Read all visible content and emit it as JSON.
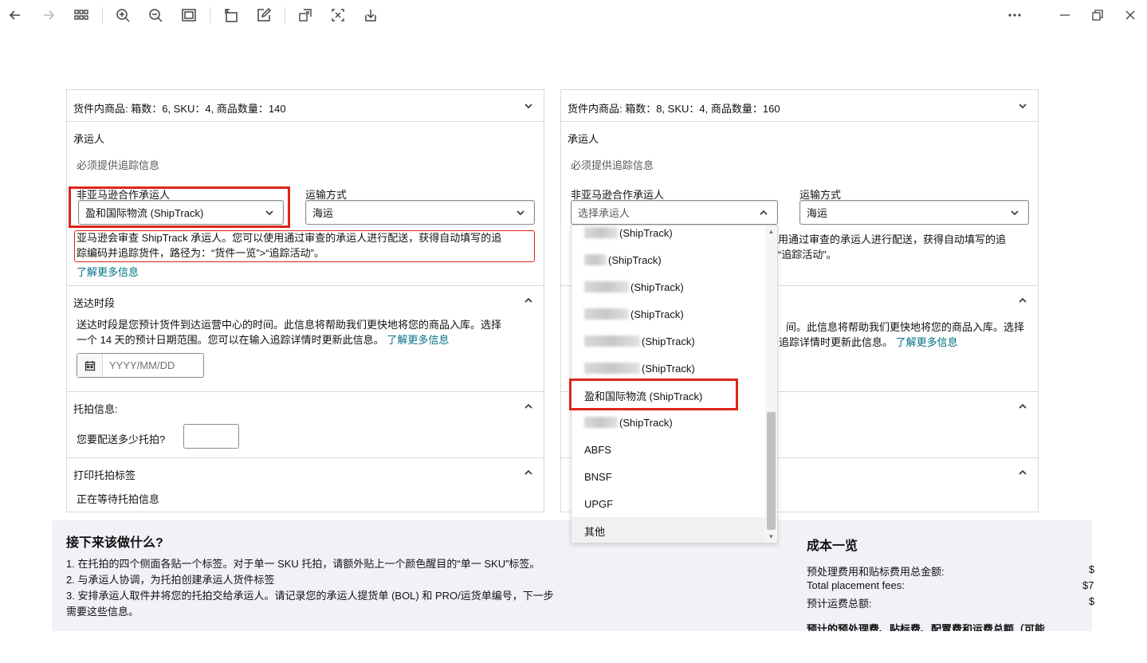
{
  "toolbar": {
    "icons": [
      "back-icon",
      "forward-icon",
      "grid-icon",
      "zoom-in-icon",
      "zoom-out-icon",
      "fit-page-icon",
      "rotate-icon",
      "edit-icon",
      "crop-icon",
      "ocr-icon",
      "download-icon",
      "more-icon",
      "minimize-icon",
      "restore-icon",
      "close-icon"
    ]
  },
  "left_panel": {
    "contents": "货件内商品: 箱数：6, SKU：4, 商品数量：140",
    "carrier_title": "承运人",
    "tracking_required": "必须提供追踪信息",
    "carrier_label": "非亚马逊合作承运人",
    "carrier_value": "盈和国际物流 (ShipTrack)",
    "mode_label": "运输方式",
    "mode_value": "海运",
    "notice_line1": "亚马逊会审查 ShipTrack 承运人。您可以使用通过审查的承运人进行配送，获得自动填写的追",
    "notice_line2": "踪编码并追踪货件，路径为：“货件一览”>“追踪活动”。",
    "learn_more": "了解更多信息",
    "delivery_title": "送达时段",
    "delivery_line1": "送达时段是您预计货件到达运营中心的时间。此信息将帮助我们更快地将您的商品入库。选择",
    "delivery_line2": "一个 14 天的预计日期范围。您可以在输入追踪详情时更新此信息。",
    "delivery_learn_more": "了解更多信息",
    "date_placeholder": "YYYY/MM/DD",
    "pallet_title": "托拍信息:",
    "pallet_question": "您要配送多少托拍?",
    "print_title": "打印托拍标签",
    "print_status": "正在等待托拍信息"
  },
  "right_panel": {
    "contents": "货件内商品: 箱数：8, SKU：4, 商品数量：160",
    "carrier_title": "承运人",
    "tracking_required": "必须提供追踪信息",
    "carrier_label": "非亚马逊合作承运人",
    "carrier_placeholder": "选择承运人",
    "mode_label": "运输方式",
    "mode_value": "海运",
    "notice_line1_partial": "用通过审查的承运人进行配送，获得自动填写的追",
    "notice_line2_partial": "“追踪活动”。",
    "delivery_partial_line1": "间。此信息将帮助我们更快地将您的商品入库。选择",
    "delivery_partial_line2": "追踪详情时更新此信息。",
    "delivery_learn_more": "了解更多信息"
  },
  "dropdown": {
    "items": [
      {
        "label": "(ShipTrack)",
        "blurred": true
      },
      {
        "label": "(ShipTrack)",
        "blurred": true
      },
      {
        "label": "(ShipTrack)",
        "blurred": true
      },
      {
        "label": "(ShipTrack)",
        "blurred": true
      },
      {
        "label": "(ShipTrack)",
        "blurred": true
      },
      {
        "label": "(ShipTrack)",
        "blurred": true
      },
      {
        "label": "盈和国际物流 (ShipTrack)",
        "blurred": false
      },
      {
        "label": "(ShipTrack)",
        "blurred": true
      },
      {
        "label": "ABFS",
        "blurred": false
      },
      {
        "label": "BNSF",
        "blurred": false
      },
      {
        "label": "UPGF",
        "blurred": false
      },
      {
        "label": "其他",
        "blurred": false
      }
    ]
  },
  "banner": {
    "title": "接下来该做什么?",
    "steps": [
      "1. 在托拍的四个侧面各贴一个标签。对于单一 SKU 托拍，请额外贴上一个颜色醒目的“单一 SKU”标签。",
      "2. 与承运人协调，为托拍创建承运人货件标签",
      "3. 安排承运人取件并将您的托拍交给承运人。请记录您的承运人提货单 (BOL) 和 PRO/运货单编号，下一步",
      "需要这些信息。"
    ],
    "cost_title": "成本一览",
    "cost_lines": [
      "预处理费用和贴标费用总金额:",
      "Total placement fees:",
      "预计运费总额:"
    ],
    "cost_values": [
      "$",
      "$7",
      "$"
    ],
    "cost_footer": "预计的预处理费、贴标费、配置费和运费总额（可能"
  }
}
